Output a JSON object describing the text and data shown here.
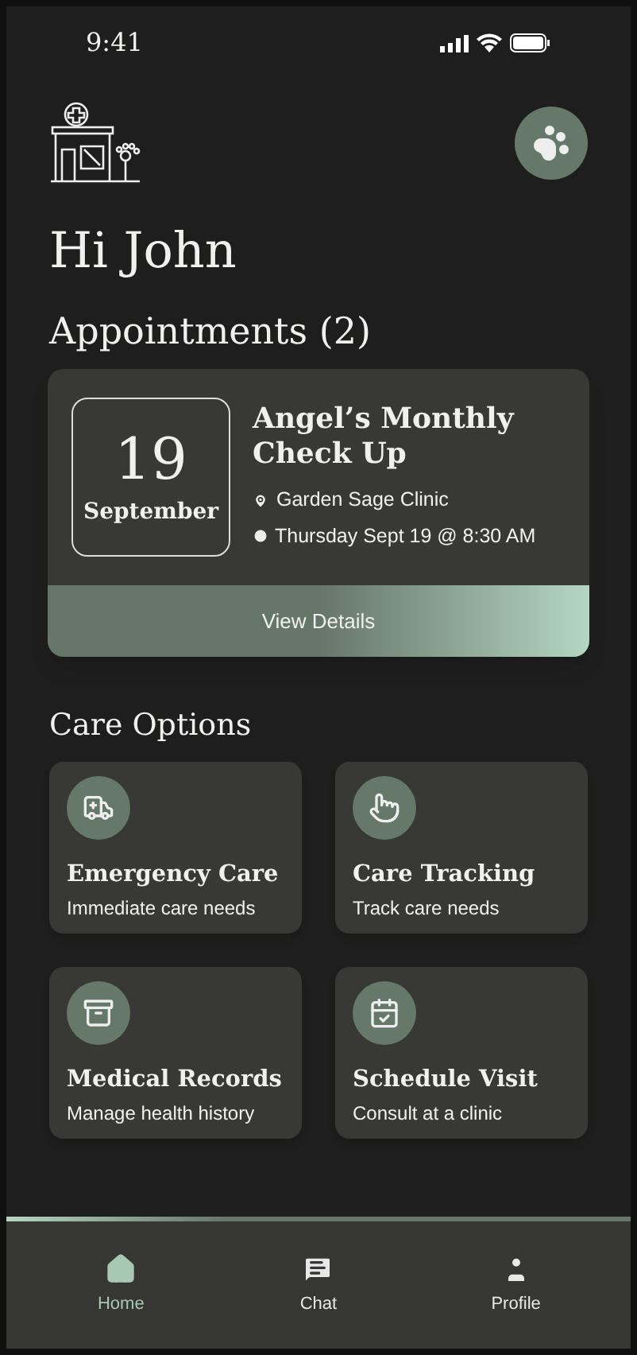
{
  "status_bar": {
    "time": "9:41"
  },
  "greeting": "Hi John",
  "appointments": {
    "heading": "Appointments (2)",
    "card": {
      "day": "19",
      "month": "September",
      "title": "Angel’s Monthly Check Up",
      "clinic": "Garden Sage Clinic",
      "when": "Thursday Sept 19 @ 8:30 AM",
      "action": "View Details"
    }
  },
  "care_options": {
    "heading": "Care Options",
    "items": [
      {
        "title": "Emergency Care",
        "subtitle": "Immediate care needs"
      },
      {
        "title": "Care Tracking",
        "subtitle": "Track care needs"
      },
      {
        "title": "Medical Records",
        "subtitle": "Manage health history"
      },
      {
        "title": "Schedule Visit",
        "subtitle": "Consult at a clinic"
      }
    ]
  },
  "nav": [
    {
      "label": "Home",
      "selected": true
    },
    {
      "label": "Chat",
      "selected": false
    },
    {
      "label": "Profile",
      "selected": false
    }
  ]
}
